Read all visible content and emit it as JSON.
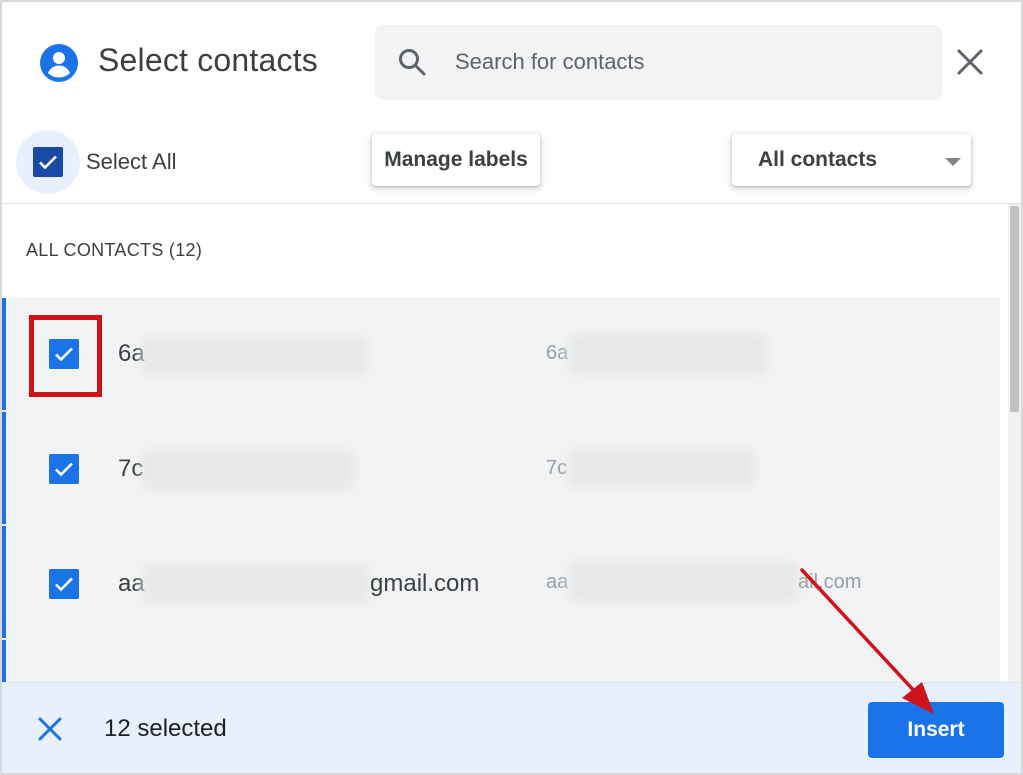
{
  "header": {
    "title": "Select contacts",
    "search_placeholder": "Search for contacts",
    "close_label": "Close"
  },
  "toolbar": {
    "select_all_label": "Select All",
    "manage_labels": "Manage labels",
    "filter_selected": "All contacts"
  },
  "list": {
    "section_title": "ALL CONTACTS (12)",
    "rows": [
      {
        "name_visible": "6a",
        "email_visible": "6a",
        "checked": true
      },
      {
        "name_visible": "7c",
        "email_visible": "7c",
        "checked": true
      },
      {
        "name_visible": "aa",
        "name_suffix": "gmail.com",
        "email_visible": "aa",
        "email_suffix": "ail.com",
        "checked": true
      }
    ]
  },
  "footer": {
    "selected_count": "12 selected",
    "insert_label": "Insert"
  },
  "colors": {
    "accent": "#1a73e8",
    "annotation": "#d0121b"
  }
}
